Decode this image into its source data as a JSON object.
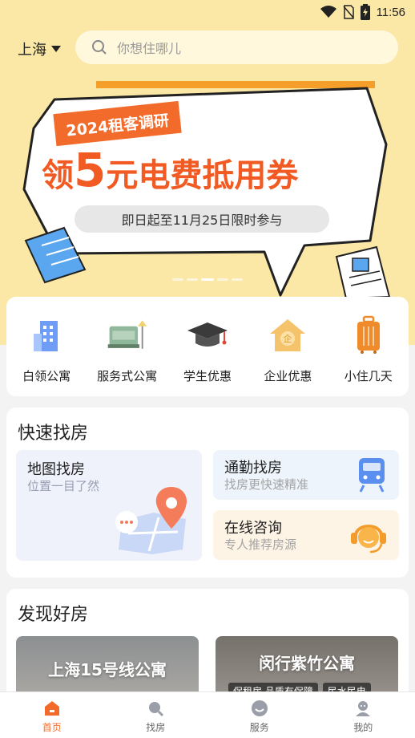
{
  "status": {
    "time": "11:56"
  },
  "header": {
    "city": "上海",
    "search_placeholder": "你想住哪儿"
  },
  "banner": {
    "tag": "2024租客调研",
    "headline_pre": "领",
    "headline_num": "5",
    "headline_post": "元电费抵用券",
    "subline": "即日起至11月25日限时参与",
    "accent_color": "#f15a22"
  },
  "categories": [
    {
      "label": "白领公寓",
      "icon": "office-building-icon"
    },
    {
      "label": "服务式公寓",
      "icon": "sofa-icon"
    },
    {
      "label": "学生优惠",
      "icon": "graduation-cap-icon"
    },
    {
      "label": "企业优惠",
      "icon": "enterprise-house-icon"
    },
    {
      "label": "小住几天",
      "icon": "luggage-icon"
    }
  ],
  "quick_find": {
    "title": "快速找房",
    "map": {
      "title": "地图找房",
      "subtitle": "位置一目了然"
    },
    "commute": {
      "title": "通勤找房",
      "subtitle": "找房更快速精准"
    },
    "consult": {
      "title": "在线咨询",
      "subtitle": "专人推荐房源"
    }
  },
  "discover": {
    "title": "发现好房",
    "cards": [
      {
        "name": "上海15号线公寓"
      },
      {
        "name": "闵行紫竹公寓",
        "badges": [
          "保租房 品质有保障",
          "民水民电"
        ]
      }
    ]
  },
  "tabbar": [
    {
      "label": "首页",
      "icon": "home-icon",
      "active": true
    },
    {
      "label": "找房",
      "icon": "search-icon"
    },
    {
      "label": "服务",
      "icon": "service-icon"
    },
    {
      "label": "我的",
      "icon": "profile-icon"
    }
  ],
  "colors": {
    "primary": "#f36b2a",
    "hero_bg": "#fbe7a6"
  }
}
